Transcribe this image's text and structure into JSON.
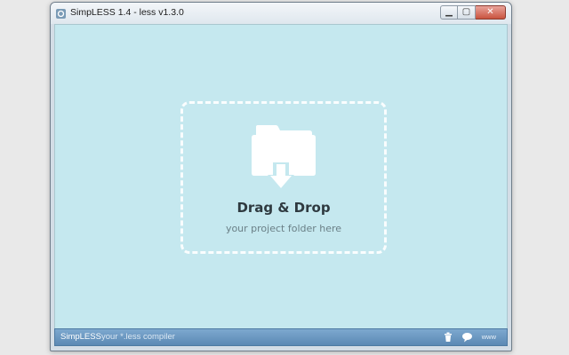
{
  "window": {
    "title": "SimpLESS 1.4 - less v1.3.0",
    "controls": {
      "minimize": "▁",
      "maximize": "▢",
      "close": "✕"
    }
  },
  "drop_zone": {
    "title": "Drag & Drop",
    "subtitle": "your project folder here",
    "icon": "folder-download-icon"
  },
  "statusbar": {
    "app_name": "SimpLESS",
    "description": "your *.less compiler",
    "icons": [
      "trash-icon",
      "chat-bubble-icon",
      "www-icon"
    ],
    "www_label": "www"
  },
  "colors": {
    "background": "#c5e8ef",
    "drop_border": "#ffffff",
    "statusbar": "#6a97c2",
    "title_text": "#2f3a40"
  }
}
